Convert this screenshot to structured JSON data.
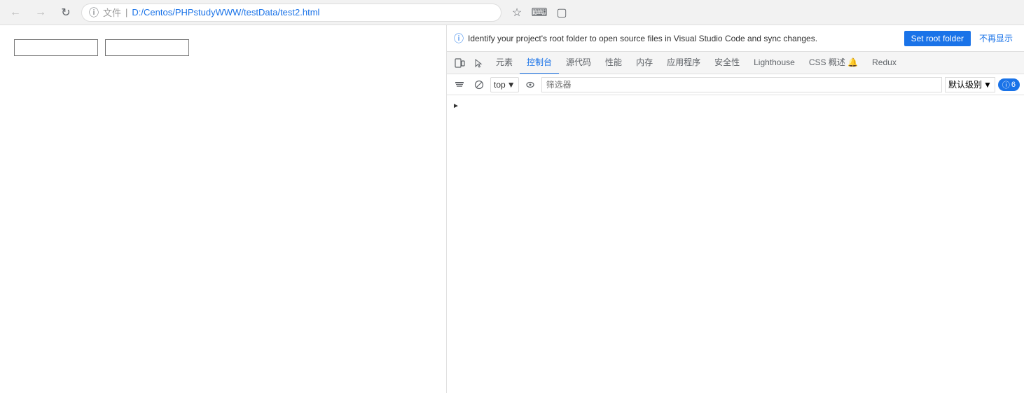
{
  "browser": {
    "back_disabled": true,
    "forward_disabled": true,
    "address": {
      "prefix_label": "文件",
      "url": "D:/Centos/PHPstudyWWW/testData/test2.html"
    }
  },
  "page": {
    "inputs": [
      {
        "id": "input1",
        "value": "",
        "placeholder": ""
      },
      {
        "id": "input2",
        "value": "",
        "placeholder": ""
      }
    ]
  },
  "devtools": {
    "info_banner": {
      "text": "Identify your project's root folder to open source files in Visual Studio Code and sync changes.",
      "set_root_label": "Set root folder",
      "dismiss_label": "不再显示"
    },
    "tabs": [
      {
        "id": "device",
        "label": "",
        "icon": "device-icon",
        "active": false
      },
      {
        "id": "inspect",
        "label": "",
        "icon": "inspect-icon",
        "active": false
      },
      {
        "id": "elements",
        "label": "元素",
        "active": false
      },
      {
        "id": "console",
        "label": "控制台",
        "active": true
      },
      {
        "id": "sources",
        "label": "源代码",
        "active": false
      },
      {
        "id": "performance",
        "label": "性能",
        "active": false
      },
      {
        "id": "memory",
        "label": "内存",
        "active": false
      },
      {
        "id": "application",
        "label": "应用程序",
        "active": false
      },
      {
        "id": "security",
        "label": "安全性",
        "active": false
      },
      {
        "id": "lighthouse",
        "label": "Lighthouse",
        "active": false
      },
      {
        "id": "css-overview",
        "label": "CSS 概述 🔔",
        "active": false
      },
      {
        "id": "redux",
        "label": "Redux",
        "active": false
      }
    ],
    "console_toolbar": {
      "clear_label": "clear",
      "top_context": "top",
      "eye_label": "eye",
      "filter_placeholder": "筛选器",
      "level_label": "默认级别",
      "issues_count": "6",
      "issues_icon": "info-icon"
    },
    "console_rows": [
      {
        "type": "chevron",
        "text": ">"
      }
    ]
  }
}
